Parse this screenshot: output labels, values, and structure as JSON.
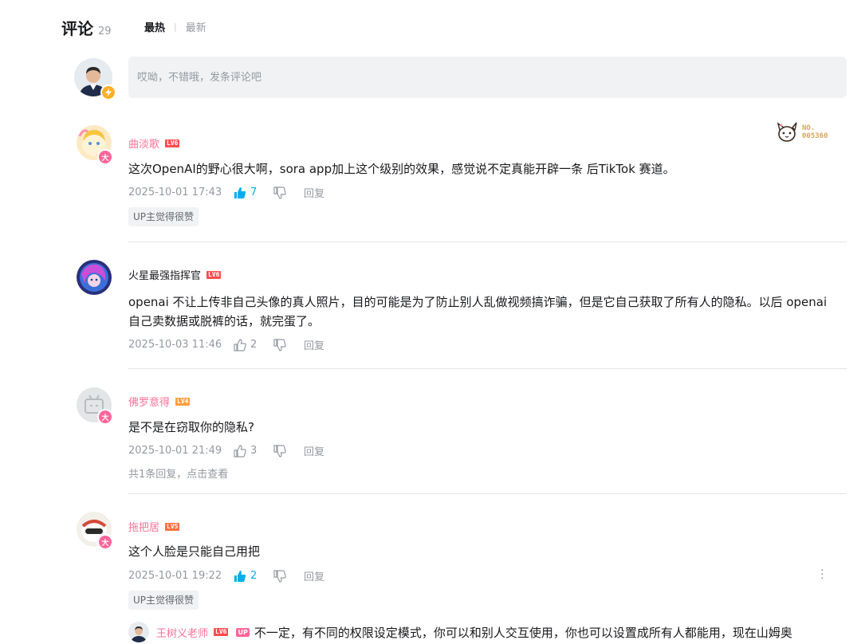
{
  "header": {
    "title": "评论",
    "count": "29",
    "sort_hot": "最热",
    "sort_sep": "|",
    "sort_new": "最新"
  },
  "input": {
    "placeholder": "哎呦，不错哦，发条评论吧"
  },
  "fan_badge": {
    "label": "NO.",
    "number": "005360"
  },
  "comments": [
    {
      "name": "曲淡歌",
      "level": "LV6",
      "text": "这次OpenAI的野心很大啊，sora app加上这个级别的效果，感觉说不定真能开辟一条 后TikTok 赛道。",
      "date": "2025-10-01 17:43",
      "likes": "7",
      "liked": true,
      "reply": "回复",
      "tag": "UP主觉得很赞"
    },
    {
      "name": "火星最强指挥官",
      "level": "LV6",
      "text": "openai 不让上传非自己头像的真人照片，目的可能是为了防止别人乱做视频搞诈骗，但是它自己获取了所有人的隐私。以后 openai 自己卖数据或脱裤的话，就完蛋了。",
      "date": "2025-10-03 11:46",
      "likes": "2",
      "liked": false,
      "reply": "回复"
    },
    {
      "name": "佛罗意得",
      "level": "LV4",
      "text": "是不是在窃取你的隐私?",
      "date": "2025-10-01 21:49",
      "likes": "3",
      "liked": false,
      "reply": "回复",
      "more": "共1条回复，点击查看"
    },
    {
      "name": "拖把居",
      "level": "LV5",
      "text": "这个人脸是只能自己用把",
      "date": "2025-10-01 19:22",
      "likes": "2",
      "liked": true,
      "reply": "回复",
      "tag": "UP主觉得很赞",
      "menu": "⋮"
    }
  ],
  "subreply": {
    "name": "王树义老师",
    "level": "LV6",
    "up": "UP",
    "text": "不一定，有不同的权限设定模式，你可以和别人交互使用，你也可以设置成所有人都能用，现在山姆奥"
  },
  "colors": {
    "accent": "#fb7299",
    "like_active": "#00aeec",
    "text": "#18191c",
    "muted": "#9499a0"
  },
  "icons": {
    "like": "thumbs-up-icon",
    "dislike": "thumbs-down-icon",
    "menu": "more-vertical-icon",
    "badge": "lightning-icon"
  }
}
